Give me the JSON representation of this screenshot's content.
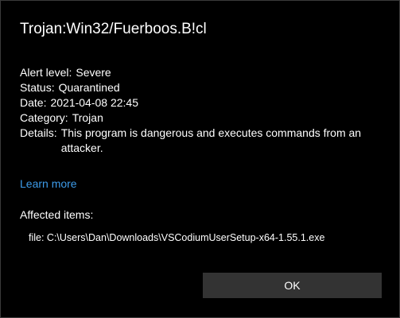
{
  "threat": {
    "name": "Trojan:Win32/Fuerboos.B!cl"
  },
  "details": [
    {
      "key": "Alert level:",
      "value": "Severe"
    },
    {
      "key": "Status:",
      "value": "Quarantined"
    },
    {
      "key": "Date:",
      "value": "2021-04-08 22:45"
    },
    {
      "key": "Category:",
      "value": "Trojan"
    },
    {
      "key": "Details:",
      "value": "This program is dangerous and executes commands from an attacker."
    }
  ],
  "learn_more": "Learn more",
  "affected": {
    "label": "Affected items:",
    "items": [
      "file: C:\\Users\\Dan\\Downloads\\VSCodiumUserSetup-x64-1.55.1.exe"
    ]
  },
  "buttons": {
    "ok": "OK"
  },
  "colors": {
    "background": "#000000",
    "text": "#ffffff",
    "link": "#3d9be9",
    "button": "#333333"
  }
}
